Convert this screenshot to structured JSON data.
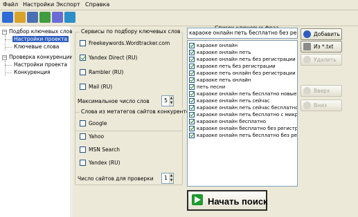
{
  "menu": {
    "items": [
      "Файл",
      "Настройки",
      "Экспорт",
      "Справка"
    ]
  },
  "toolbar": {
    "icons": [
      {
        "name": "new-project-icon",
        "color": "#2d6bd6"
      },
      {
        "name": "open-folder-icon",
        "color": "#d9a32a"
      },
      {
        "name": "save-icon",
        "color": "#4a6fb3"
      },
      {
        "name": "export-icon",
        "color": "#3f9d3f"
      },
      {
        "name": "settings-icon",
        "color": "#6b6bd6"
      },
      {
        "name": "globe-icon",
        "color": "#2c8fc9"
      }
    ]
  },
  "tree": {
    "group1": {
      "label": "Подбор ключевых слов",
      "expander": "−",
      "children": [
        "Настройки проекта",
        "Ключевые слова"
      ]
    },
    "group2": {
      "label": "Проверка конкуренции",
      "expander": "−",
      "children": [
        "Настройки проекта",
        "Конкуренция"
      ]
    }
  },
  "services": {
    "legend": "Сервисы по подбору ключевых слов",
    "items": [
      {
        "label": "Freekeywords.Wordtracker.com",
        "checked": false
      },
      {
        "label": "Yandex Direct (RU)",
        "checked": true
      },
      {
        "label": "Rambler (RU)",
        "checked": false
      },
      {
        "label": "Mail (RU)",
        "checked": false
      }
    ],
    "max_words_label": "Максимальное число слов",
    "max_words_value": "5"
  },
  "competitors": {
    "legend": "Слова из метатегов сайтов конкурентов",
    "items": [
      {
        "label": "Google",
        "checked": false
      },
      {
        "label": "Yahoo",
        "checked": false
      },
      {
        "label": "MSN Search",
        "checked": false
      },
      {
        "label": "Yandex (RU)",
        "checked": false
      }
    ],
    "sites_label": "Число сайтов для проверки",
    "sites_value": "1"
  },
  "phrases": {
    "title": "Список ключевых фраз",
    "input_value": "караоке онлайн петь бесплатно без регистрации",
    "items": [
      {
        "label": "караоке онлайн",
        "checked": true
      },
      {
        "label": "караоке онлайн петь",
        "checked": true
      },
      {
        "label": "караоке онлайн петь без регистрации",
        "checked": true
      },
      {
        "label": "караоке петь без регистрации",
        "checked": true
      },
      {
        "label": "караоке петь онлайн без регистрации",
        "checked": true
      },
      {
        "label": "караоке петь онлайн",
        "checked": true
      },
      {
        "label": "петь песни",
        "checked": true
      },
      {
        "label": "караоке онлайн петь бесплатно новые песни",
        "checked": true
      },
      {
        "label": "караоке онлайн петь сейчас",
        "checked": true
      },
      {
        "label": "караоке онлайн петь сейчас бесплатно",
        "checked": true
      },
      {
        "label": "караоке онлайн петь бесплатно с микрофоном",
        "checked": true
      },
      {
        "label": "караоке онлайн бесплатно",
        "checked": true
      },
      {
        "label": "караоке онлайн бесплатно без регистрации",
        "checked": true
      },
      {
        "label": "караоке онлайн петь бесплатно без регистрации",
        "checked": true
      }
    ]
  },
  "buttons": {
    "add": "Добавить",
    "from_txt": "Из *.txt",
    "delete": "Удалить",
    "up": "Вверх",
    "down": "Вниз",
    "start": "Начать поиск"
  },
  "colors": {
    "accent": "#2e5dbd",
    "checkmark": "#1f8a1f",
    "start_arrow": "#1e9a2e"
  }
}
